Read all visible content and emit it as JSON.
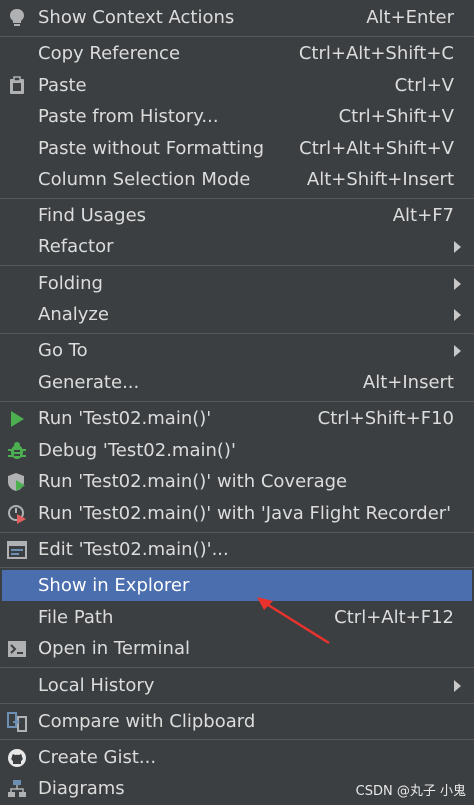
{
  "menu": {
    "show_context_actions": {
      "label": "Show Context Actions",
      "shortcut": "Alt+Enter",
      "icon": "lightbulb-icon"
    },
    "copy_reference": {
      "label": "Copy Reference",
      "shortcut": "Ctrl+Alt+Shift+C"
    },
    "paste": {
      "label": "Paste",
      "shortcut": "Ctrl+V",
      "icon": "clipboard-icon"
    },
    "paste_from_history": {
      "label": "Paste from History...",
      "shortcut": "Ctrl+Shift+V"
    },
    "paste_without_formatting": {
      "label": "Paste without Formatting",
      "shortcut": "Ctrl+Alt+Shift+V"
    },
    "column_selection_mode": {
      "label": "Column Selection Mode",
      "shortcut": "Alt+Shift+Insert"
    },
    "find_usages": {
      "label": "Find Usages",
      "shortcut": "Alt+F7"
    },
    "refactor": {
      "label": "Refactor"
    },
    "folding": {
      "label": "Folding"
    },
    "analyze": {
      "label": "Analyze"
    },
    "go_to": {
      "label": "Go To"
    },
    "generate": {
      "label": "Generate...",
      "shortcut": "Alt+Insert"
    },
    "run": {
      "label": "Run 'Test02.main()'",
      "shortcut": "Ctrl+Shift+F10",
      "icon": "run-icon"
    },
    "debug": {
      "label": "Debug 'Test02.main()'",
      "icon": "debug-bug-icon"
    },
    "run_coverage": {
      "label": "Run 'Test02.main()' with Coverage",
      "icon": "coverage-icon"
    },
    "run_jfr": {
      "label": "Run 'Test02.main()' with 'Java Flight Recorder'",
      "icon": "flight-recorder-icon"
    },
    "edit_config": {
      "label": "Edit 'Test02.main()'...",
      "icon": "edit-config-icon"
    },
    "show_in_explorer": {
      "label": "Show in Explorer"
    },
    "file_path": {
      "label": "File Path",
      "shortcut": "Ctrl+Alt+F12"
    },
    "open_in_terminal": {
      "label": "Open in Terminal",
      "icon": "terminal-icon"
    },
    "local_history": {
      "label": "Local History"
    },
    "compare_clipboard": {
      "label": "Compare with Clipboard",
      "icon": "compare-icon"
    },
    "create_gist": {
      "label": "Create Gist...",
      "icon": "github-icon"
    },
    "diagrams": {
      "label": "Diagrams",
      "icon": "diagram-icon"
    }
  },
  "watermark": "CSDN @丸子 小鬼",
  "colors": {
    "background": "#3c3f41",
    "selected": "#4b6eaf",
    "separator": "#555759",
    "text": "#dcdcdc",
    "run_green": "#4caf50",
    "annotation_red": "#e8322d"
  }
}
